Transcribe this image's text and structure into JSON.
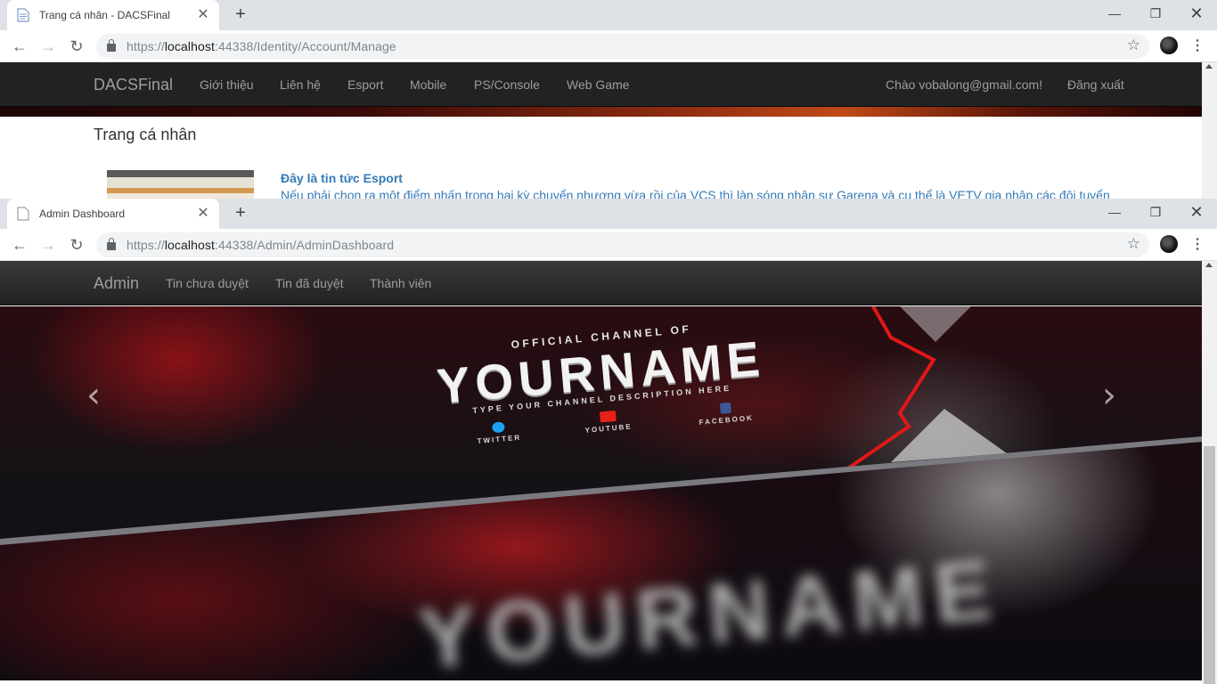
{
  "window1": {
    "tab_title": "Trang cá nhân - DACSFinal",
    "url_scheme": "https://",
    "url_host": "localhost",
    "url_rest": ":44338/Identity/Account/Manage",
    "brand": "DACSFinal",
    "nav": [
      "Giới thiệu",
      "Liên hệ",
      "Esport",
      "Mobile",
      "PS/Console",
      "Web Game"
    ],
    "greeting": "Chào vobalong@gmail.com!",
    "logout": "Đăng xuất",
    "page_title": "Trang cá nhân",
    "news_title": "Đây là tin tức Esport",
    "news_desc": "Nếu phải chọn ra một điểm nhấn trong hai kỳ chuyển nhượng vừa rồi của VCS thì làn sóng nhân sự Garena và cụ thể là VETV gia nhập các đội tuyển"
  },
  "window2": {
    "tab_title": "Admin Dashboard",
    "url_scheme": "https://",
    "url_host": "localhost",
    "url_rest": ":44338/Admin/AdminDashboard",
    "brand": "Admin",
    "nav": [
      "Tin chưa duyệt",
      "Tin đã duyệt",
      "Thành viên"
    ]
  },
  "banner": {
    "official": "OFFICIAL CHANNEL OF",
    "name": "YOURNAME",
    "description": "TYPE YOUR CHANNEL DESCRIPTION HERE",
    "socials": [
      {
        "label": "TWITTER",
        "icon": "twitter-icon",
        "color": "#1da1f2"
      },
      {
        "label": "YOUTUBE",
        "icon": "youtube-icon",
        "color": "#e62117"
      },
      {
        "label": "FACEBOOK",
        "icon": "facebook-icon",
        "color": "#3b5998"
      }
    ],
    "blurred_name": "YOURNAME"
  },
  "colors": {
    "navbar_bg": "#222222",
    "nav_text": "#9d9d9d",
    "link_blue": "#337ab7",
    "banner_red": "#e01818"
  }
}
